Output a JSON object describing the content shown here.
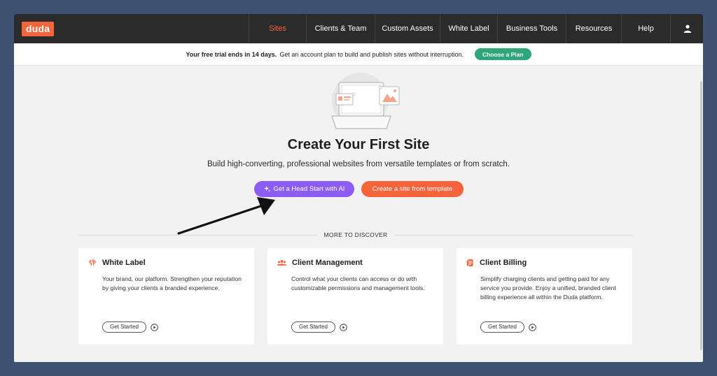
{
  "logo": "duda",
  "nav": {
    "items": [
      "Sites",
      "Clients & Team",
      "Custom Assets",
      "White Label",
      "Business Tools",
      "Resources",
      "Help"
    ],
    "user_icon": "user-icon"
  },
  "banner": {
    "bold": "Your free trial ends in 14 days.",
    "text": "Get an account plan to build and publish sites without interruption.",
    "button": "Choose a Plan"
  },
  "hero": {
    "title": "Create Your First Site",
    "subtitle": "Build high-converting, professional websites from versatile templates or from scratch.",
    "ai_button": "Get a Head Start with AI",
    "template_button": "Create a site from template"
  },
  "discover_label": "MORE TO DISCOVER",
  "cards": [
    {
      "icon": "fingerprint-icon",
      "title": "White Label",
      "desc": "Your brand, our platform. Strengthen your reputation by giving your clients a branded experience.",
      "button": "Get Started"
    },
    {
      "icon": "team-icon",
      "title": "Client Management",
      "desc": "Control what your clients can access or do with customizable permissions and management tools.",
      "button": "Get Started"
    },
    {
      "icon": "invoice-icon",
      "title": "Client Billing",
      "desc": "Simplify charging clients and getting paid for any service you provide. Enjoy a unified, branded client billing experience all within the Duda platform.",
      "button": "Get Started"
    }
  ],
  "colors": {
    "accent": "#f5643a",
    "ai": "#8b5cf6",
    "plan": "#2fa679",
    "nav_bg": "#2b2b2b",
    "backdrop": "#3d5273"
  }
}
